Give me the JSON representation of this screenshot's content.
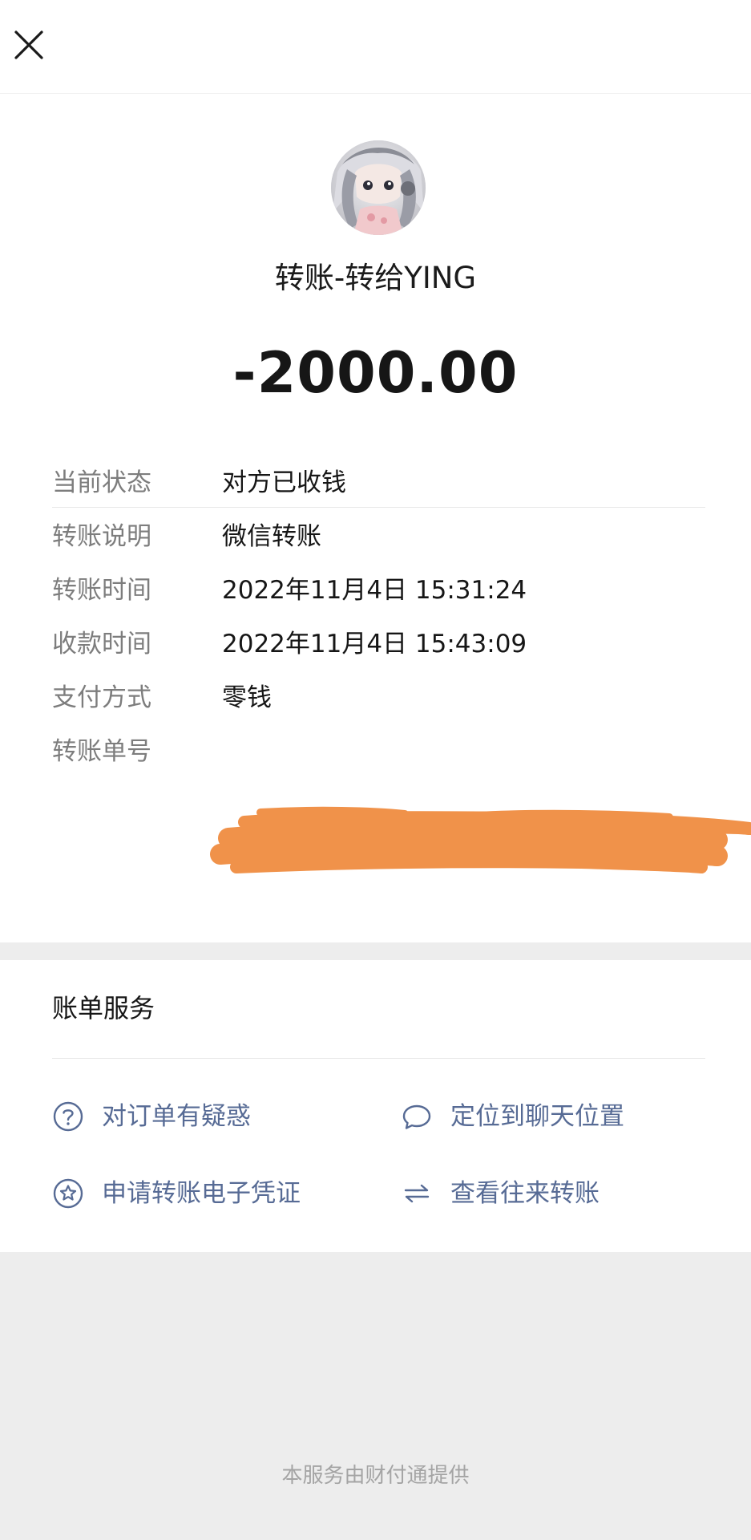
{
  "header": {
    "close_icon": "close-icon"
  },
  "transfer": {
    "avatar_icon": "avatar",
    "title": "转账-转给YING",
    "amount": "-2000.00"
  },
  "details": [
    {
      "label": "当前状态",
      "value": "对方已收钱"
    },
    {
      "label": "转账说明",
      "value": "微信转账"
    },
    {
      "label": "转账时间",
      "value": "2022年11月4日 15:31:24"
    },
    {
      "label": "收款时间",
      "value": "2022年11月4日 15:43:09"
    },
    {
      "label": "支付方式",
      "value": "零钱"
    },
    {
      "label": "转账单号",
      "value": ""
    }
  ],
  "services": {
    "title": "账单服务",
    "items": [
      {
        "label": "对订单有疑惑",
        "icon": "question-circle-icon"
      },
      {
        "label": "定位到聊天位置",
        "icon": "chat-bubble-icon"
      },
      {
        "label": "申请转账电子凭证",
        "icon": "star-circle-icon"
      },
      {
        "label": "查看往来转账",
        "icon": "swap-arrows-icon"
      }
    ]
  },
  "footer": {
    "text": "本服务由财付通提供"
  },
  "colors": {
    "link": "#576b95",
    "label": "#7d7d7d",
    "redaction": "#f0924a",
    "background": "#ededed"
  }
}
